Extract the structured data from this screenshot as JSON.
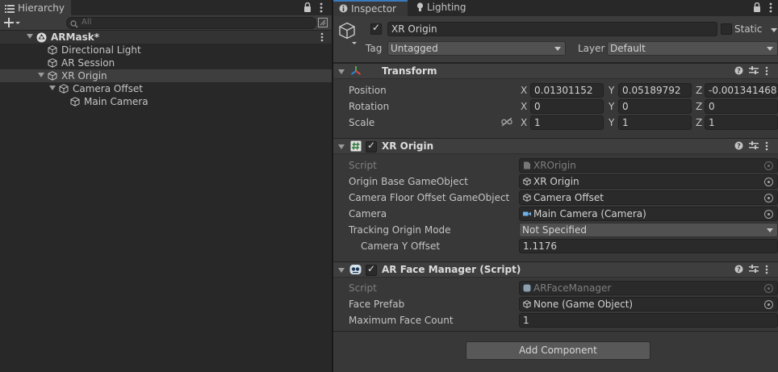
{
  "hierarchy": {
    "tab_label": "Hierarchy",
    "search_placeholder": "All",
    "scene_name": "ARMask*",
    "items": [
      {
        "label": "Directional Light"
      },
      {
        "label": "AR Session"
      },
      {
        "label": "XR Origin"
      },
      {
        "label": "Camera Offset"
      },
      {
        "label": "Main Camera"
      }
    ],
    "selected": "XR Origin"
  },
  "inspector": {
    "tabs": [
      {
        "label": "Inspector"
      },
      {
        "label": "Lighting"
      }
    ],
    "object": {
      "name": "XR Origin",
      "active": true,
      "static_label": "Static",
      "tag_label": "Tag",
      "tag_value": "Untagged",
      "layer_label": "Layer",
      "layer_value": "Default"
    },
    "transform": {
      "title": "Transform",
      "position_label": "Position",
      "rotation_label": "Rotation",
      "scale_label": "Scale",
      "axis_x": "X",
      "axis_y": "Y",
      "axis_z": "Z",
      "position": {
        "x": "0.01301152",
        "y": "0.05189792",
        "z": "-0.001341468"
      },
      "rotation": {
        "x": "0",
        "y": "0",
        "z": "0"
      },
      "scale": {
        "x": "1",
        "y": "1",
        "z": "1"
      }
    },
    "xr_origin": {
      "title": "XR Origin",
      "enabled": true,
      "script_label": "Script",
      "script_value": "XROrigin",
      "origin_base_label": "Origin Base GameObject",
      "origin_base_value": "XR Origin",
      "camera_floor_label": "Camera Floor Offset GameObject",
      "camera_floor_value": "Camera Offset",
      "camera_label": "Camera",
      "camera_value": "Main Camera (Camera)",
      "tracking_mode_label": "Tracking Origin Mode",
      "tracking_mode_value": "Not Specified",
      "camera_y_offset_label": "Camera Y Offset",
      "camera_y_offset_value": "1.1176"
    },
    "ar_face_manager": {
      "title": "AR Face Manager (Script)",
      "enabled": true,
      "script_label": "Script",
      "script_value": "ARFaceManager",
      "face_prefab_label": "Face Prefab",
      "face_prefab_value": "None (Game Object)",
      "max_face_count_label": "Maximum Face Count",
      "max_face_count_value": "1"
    },
    "add_component_label": "Add Component"
  },
  "colors": {
    "accent": "#3a79bb",
    "panel": "#383838",
    "field": "#2a2a2a"
  }
}
